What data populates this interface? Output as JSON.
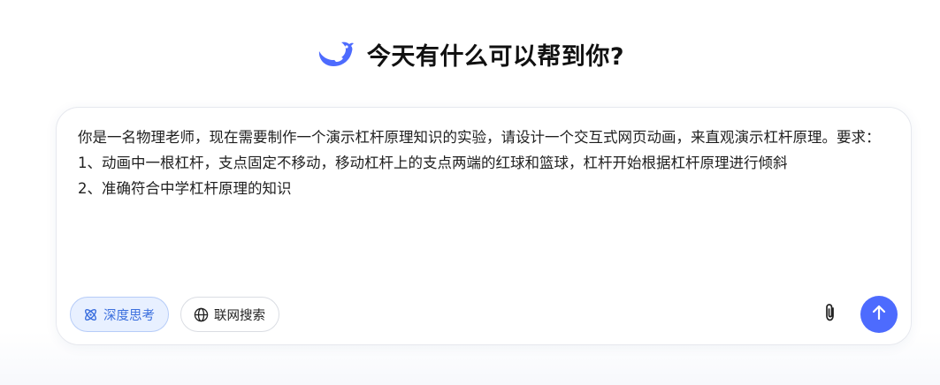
{
  "header": {
    "logo_icon": "deepseek-whale-icon",
    "title": "今天有什么可以帮到你?"
  },
  "composer": {
    "prompt": "你是一名物理老师，现在需要制作一个演示杠杆原理知识的实验，请设计一个交互式网页动画，来直观演示杠杆原理。要求：\n1、动画中一根杠杆，支点固定不移动，移动杠杆上的支点两端的红球和篮球，杠杆开始根据杠杆原理进行倾斜\n2、准确符合中学杠杆原理的知识",
    "deep_think": {
      "label": "深度思考",
      "icon": "atom-icon",
      "active": true
    },
    "web_search": {
      "label": "联网搜索",
      "icon": "globe-icon",
      "active": false
    },
    "attach_icon": "paperclip-icon",
    "send_icon": "arrow-up-icon"
  },
  "colors": {
    "accent": "#4d6bfe",
    "chip_active_bg": "#e8f0ff",
    "chip_active_text": "#3b6fde"
  }
}
